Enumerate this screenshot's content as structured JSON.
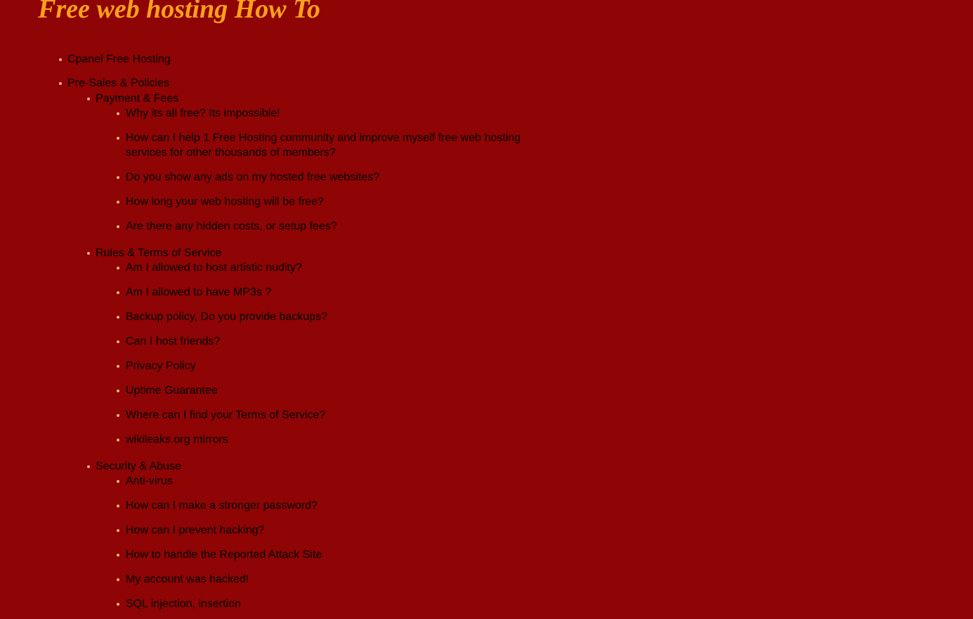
{
  "page": {
    "background_color": "#8f0404",
    "text_color": "#e8821c",
    "title_color": "#f9a11b",
    "bullet_color": "#ecb48a",
    "title": "Free web hosting How To"
  },
  "outline": {
    "items": [
      {
        "label": "Cpanel Free Hosting",
        "level": 1,
        "children": []
      },
      {
        "label": "Pre-Sales & Policies",
        "level": 1,
        "children": [
          {
            "label": "Payment & Fees",
            "level": 2,
            "children": [
              {
                "label": "Why its all free? Its impossible!",
                "level": 3
              },
              {
                "label": "How can I help 1 Free Hosting community and improve myself free web hosting services for other thousands of members?",
                "level": 3
              },
              {
                "label": "Do you show any ads on my hosted free websites?",
                "level": 3
              },
              {
                "label": "How long your web hosting will be free?",
                "level": 3
              },
              {
                "label": "Are there any hidden costs, or setup fees?",
                "level": 3
              }
            ]
          },
          {
            "label": "Rules & Terms of Service",
            "level": 2,
            "children": [
              {
                "label": "Am I allowed to host artistic nudity?",
                "level": 3
              },
              {
                "label": "Am I allowed to have MP3s ?",
                "level": 3
              },
              {
                "label": "Backup policy, Do you provide backups?",
                "level": 3
              },
              {
                "label": "Can I host friends?",
                "level": 3
              },
              {
                "label": "Privacy Policy",
                "level": 3
              },
              {
                "label": "Uptime Guarantee",
                "level": 3
              },
              {
                "label": "Where can I find your Terms of Service?",
                "level": 3
              },
              {
                "label": "wikileaks.org mirrors",
                "level": 3
              }
            ]
          },
          {
            "label": "Security & Abuse",
            "level": 2,
            "children": [
              {
                "label": "Anti-virus",
                "level": 3
              },
              {
                "label": "How can I make a stronger password?",
                "level": 3
              },
              {
                "label": "How can I prevent hacking?",
                "level": 3
              },
              {
                "label": "How to handle the Reported Attack Site",
                "level": 3
              },
              {
                "label": "My account was hacked!",
                "level": 3
              },
              {
                "label": "SQL injection, insertion",
                "level": 3
              }
            ]
          }
        ]
      }
    ]
  }
}
